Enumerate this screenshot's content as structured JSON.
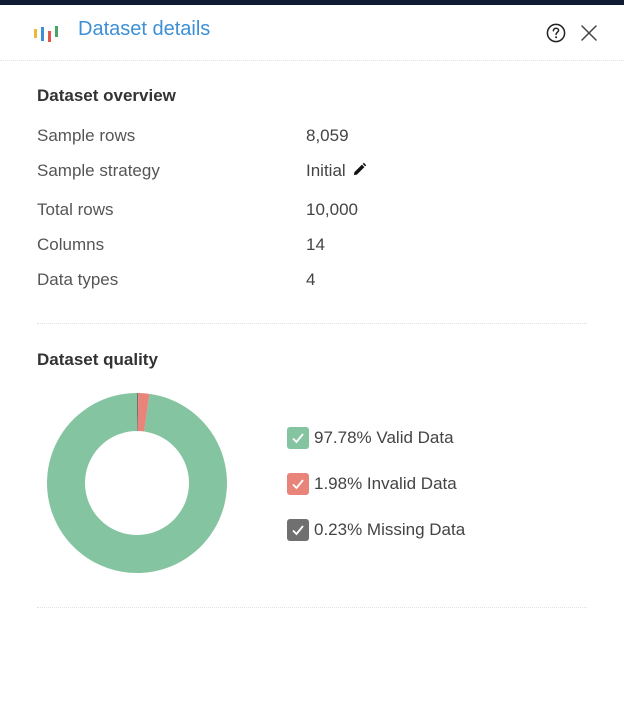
{
  "header": {
    "title": "Dataset details"
  },
  "overview": {
    "title": "Dataset overview",
    "rows": [
      {
        "label": "Sample rows",
        "value": "8,059"
      },
      {
        "label": "Sample strategy",
        "value": "Initial"
      },
      {
        "label": "Total rows",
        "value": "10,000"
      },
      {
        "label": "Columns",
        "value": "14"
      },
      {
        "label": "Data types",
        "value": "4"
      }
    ]
  },
  "quality": {
    "title": "Dataset quality",
    "legend": [
      {
        "label": "97.78% Valid Data",
        "percent": 97.78,
        "color": "#85c4a0"
      },
      {
        "label": "1.98% Invalid Data",
        "percent": 1.98,
        "color": "#e8847a"
      },
      {
        "label": "0.23% Missing Data",
        "percent": 0.23,
        "color": "#707070"
      }
    ]
  },
  "icons": {
    "logo": "bar-chart-logo-icon",
    "help": "question-circle-icon",
    "close": "close-icon",
    "edit": "pencil-icon",
    "check": "check-icon"
  }
}
